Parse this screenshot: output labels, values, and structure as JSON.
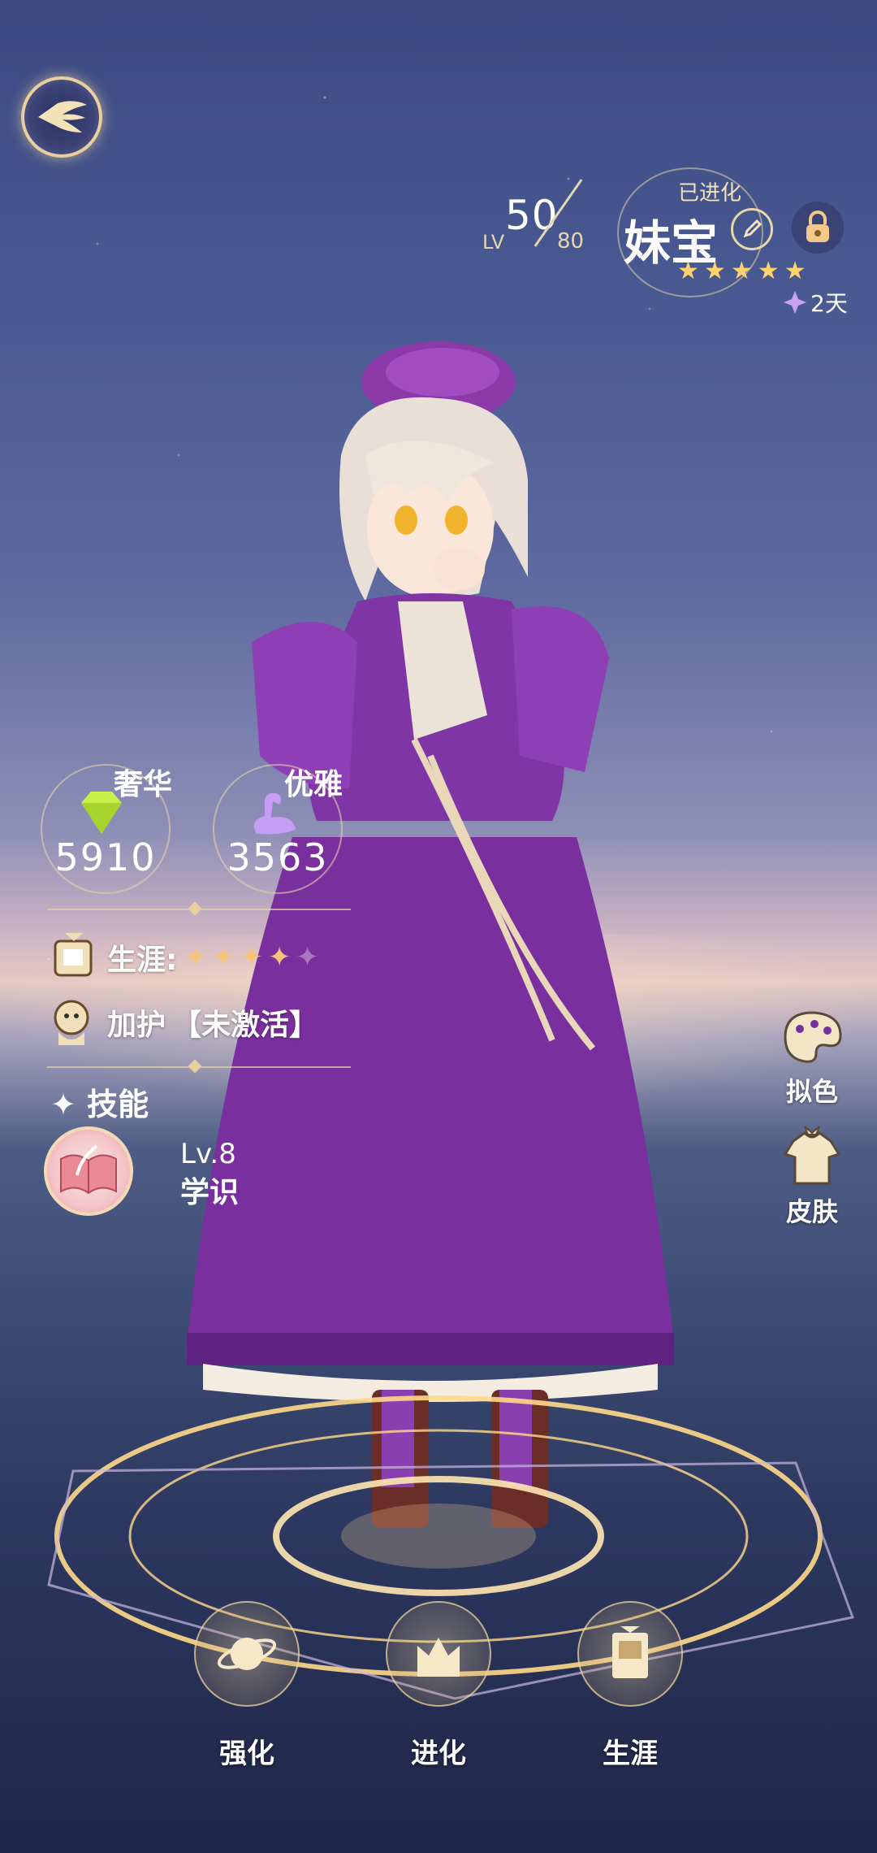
{
  "header": {
    "back_icon": "wing-back-icon",
    "level": {
      "label": "LV",
      "current": "50",
      "max": "80"
    },
    "character": {
      "status": "已进化",
      "name": "妹宝",
      "rating_stars": 5,
      "timer": "2天"
    }
  },
  "stats": {
    "luxury": {
      "label": "奢华",
      "value": "5910",
      "icon": "diamond-icon",
      "color": "#c8f04a"
    },
    "elegance": {
      "label": "优雅",
      "value": "3563",
      "icon": "swan-icon",
      "color": "#c79cf5"
    }
  },
  "career": {
    "label": "生涯:",
    "stars_filled": 4,
    "stars_total": 5
  },
  "blessing": {
    "label": "加护",
    "value": "【未激活】"
  },
  "skills": {
    "title": "技能",
    "items": [
      {
        "level": "Lv.8",
        "name": "学识",
        "icon": "book-quill-icon"
      }
    ]
  },
  "side_buttons": [
    {
      "label": "拟色",
      "icon": "palette-icon"
    },
    {
      "label": "皮肤",
      "icon": "costume-icon"
    }
  ],
  "actions": [
    {
      "label": "强化",
      "icon": "planet-icon"
    },
    {
      "label": "进化",
      "icon": "crown-icon"
    },
    {
      "label": "生涯",
      "icon": "scroll-card-icon"
    }
  ],
  "colors": {
    "gold": "#e8cf9d",
    "dress": "#7a2f9e",
    "sky": "#4b5b93"
  }
}
